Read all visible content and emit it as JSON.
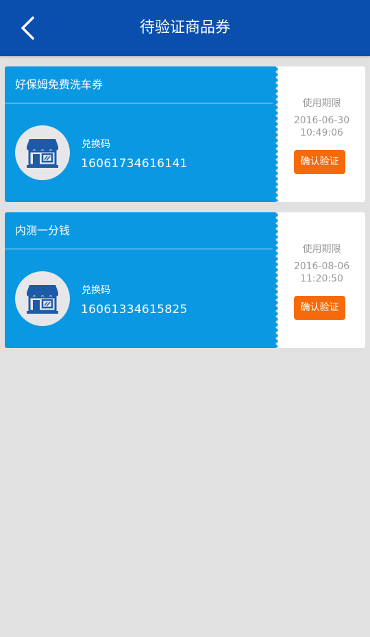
{
  "header": {
    "title": "待验证商品券",
    "back_icon": "chevron-left-icon"
  },
  "colors": {
    "header_bg": "#0a4fae",
    "coupon_bg": "#0a98e3",
    "button_bg": "#f56a0a",
    "page_bg": "#e1e1e1"
  },
  "coupons": [
    {
      "name": "好保姆免费洗车券",
      "icon": "store-icon",
      "code_label": "兑换码",
      "code": "16061734616141",
      "validity_label": "使用期限",
      "validity_date": "2016-06-30",
      "validity_time": "10:49:06",
      "button_label": "确认验证"
    },
    {
      "name": "内测一分钱",
      "icon": "store-icon",
      "code_label": "兑换码",
      "code": "16061334615825",
      "validity_label": "使用期限",
      "validity_date": "2016-08-06",
      "validity_time": "11:20:50",
      "button_label": "确认验证"
    }
  ]
}
